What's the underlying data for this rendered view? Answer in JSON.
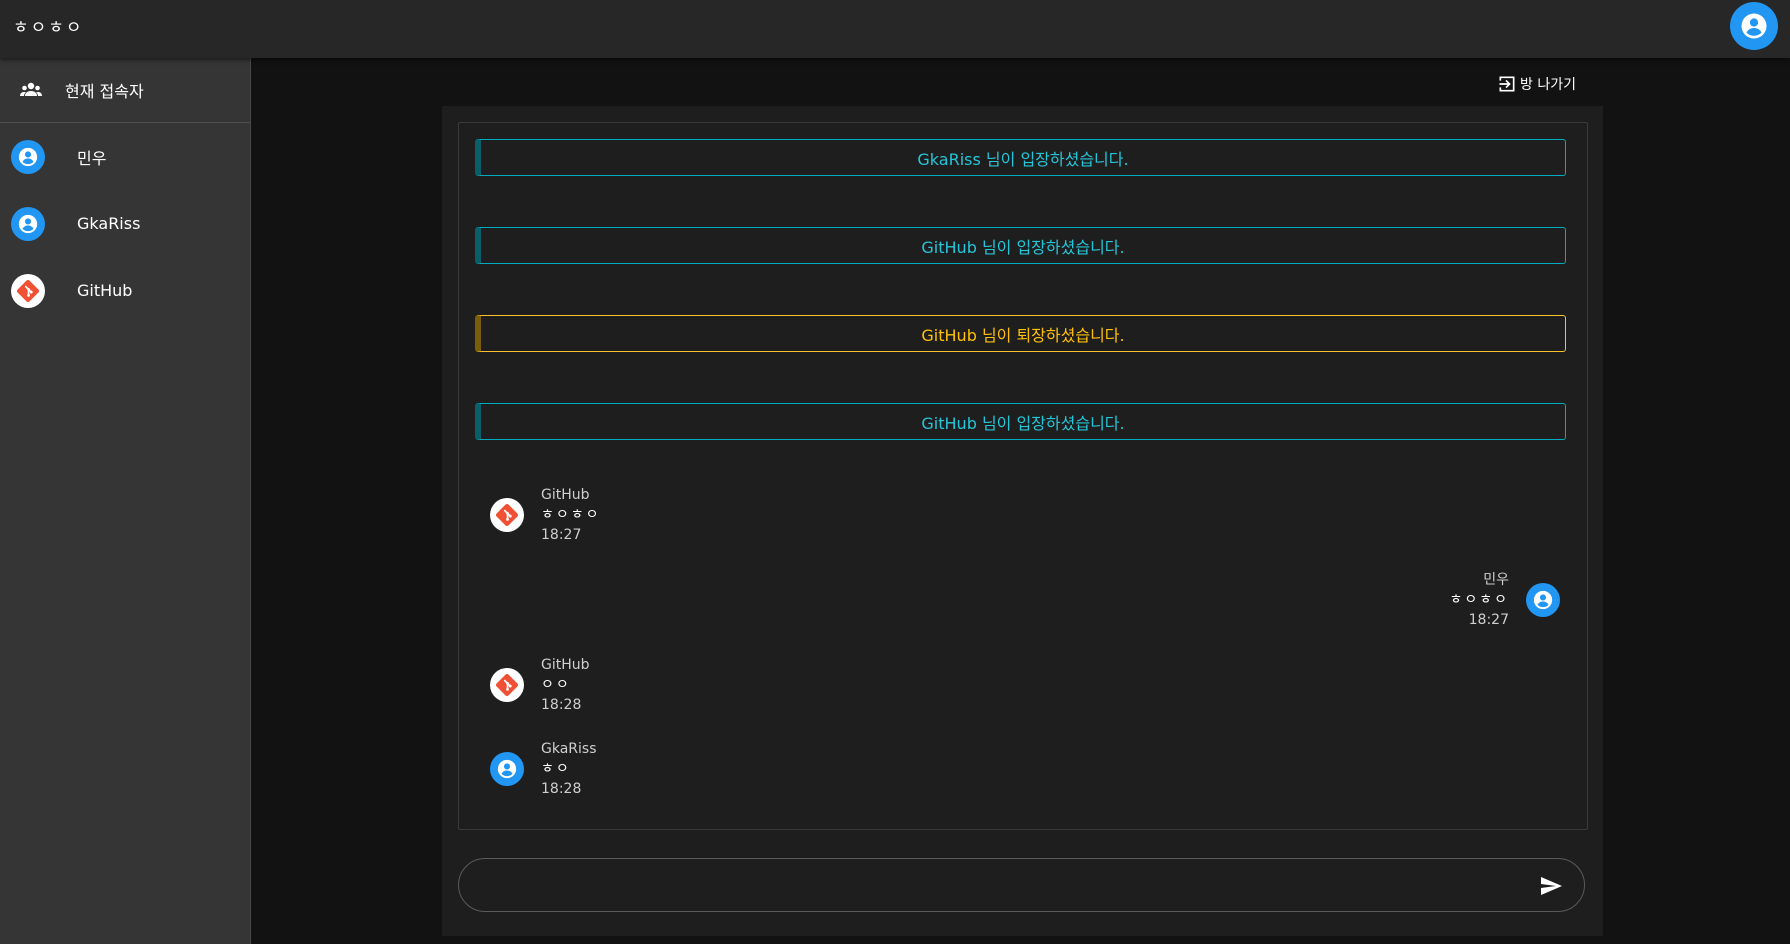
{
  "app": {
    "title": "ㅎㅇㅎㅇ"
  },
  "sidebar": {
    "header_label": "현재 접속자",
    "users": [
      {
        "name": "민우",
        "avatar": "user-circle-icon",
        "color": "#2196f3"
      },
      {
        "name": "GkaRiss",
        "avatar": "user-circle-icon",
        "color": "#2196f3"
      },
      {
        "name": "GitHub",
        "avatar": "git-icon",
        "color": "#f05033"
      }
    ]
  },
  "room": {
    "leave_label": "방 나가기"
  },
  "notices": [
    {
      "text": "GkaRiss 님이 입장하셨습니다.",
      "kind": "join"
    },
    {
      "text": "GitHub 님이 입장하셨습니다.",
      "kind": "join"
    },
    {
      "text": "GitHub 님이 퇴장하셨습니다.",
      "kind": "leave"
    },
    {
      "text": "GitHub 님이 입장하셨습니다.",
      "kind": "join"
    }
  ],
  "messages": [
    {
      "sender": "GitHub",
      "text": "ㅎㅇㅎㅇ",
      "time": "18:27",
      "side": "left",
      "avatar": "git-icon"
    },
    {
      "sender": "민우",
      "text": "ㅎㅇㅎㅇ",
      "time": "18:27",
      "side": "right",
      "avatar": "user-circle-icon"
    },
    {
      "sender": "GitHub",
      "text": "ㅇㅇ",
      "time": "18:28",
      "side": "left",
      "avatar": "git-icon"
    },
    {
      "sender": "GkaRiss",
      "text": "ㅎㅇ",
      "time": "18:28",
      "side": "left",
      "avatar": "user-circle-icon"
    }
  ],
  "input": {
    "value": "",
    "placeholder": ""
  },
  "colors": {
    "accent": "#2196f3",
    "join": "#26c6da",
    "leave": "#ffc107",
    "git": "#f05033"
  }
}
